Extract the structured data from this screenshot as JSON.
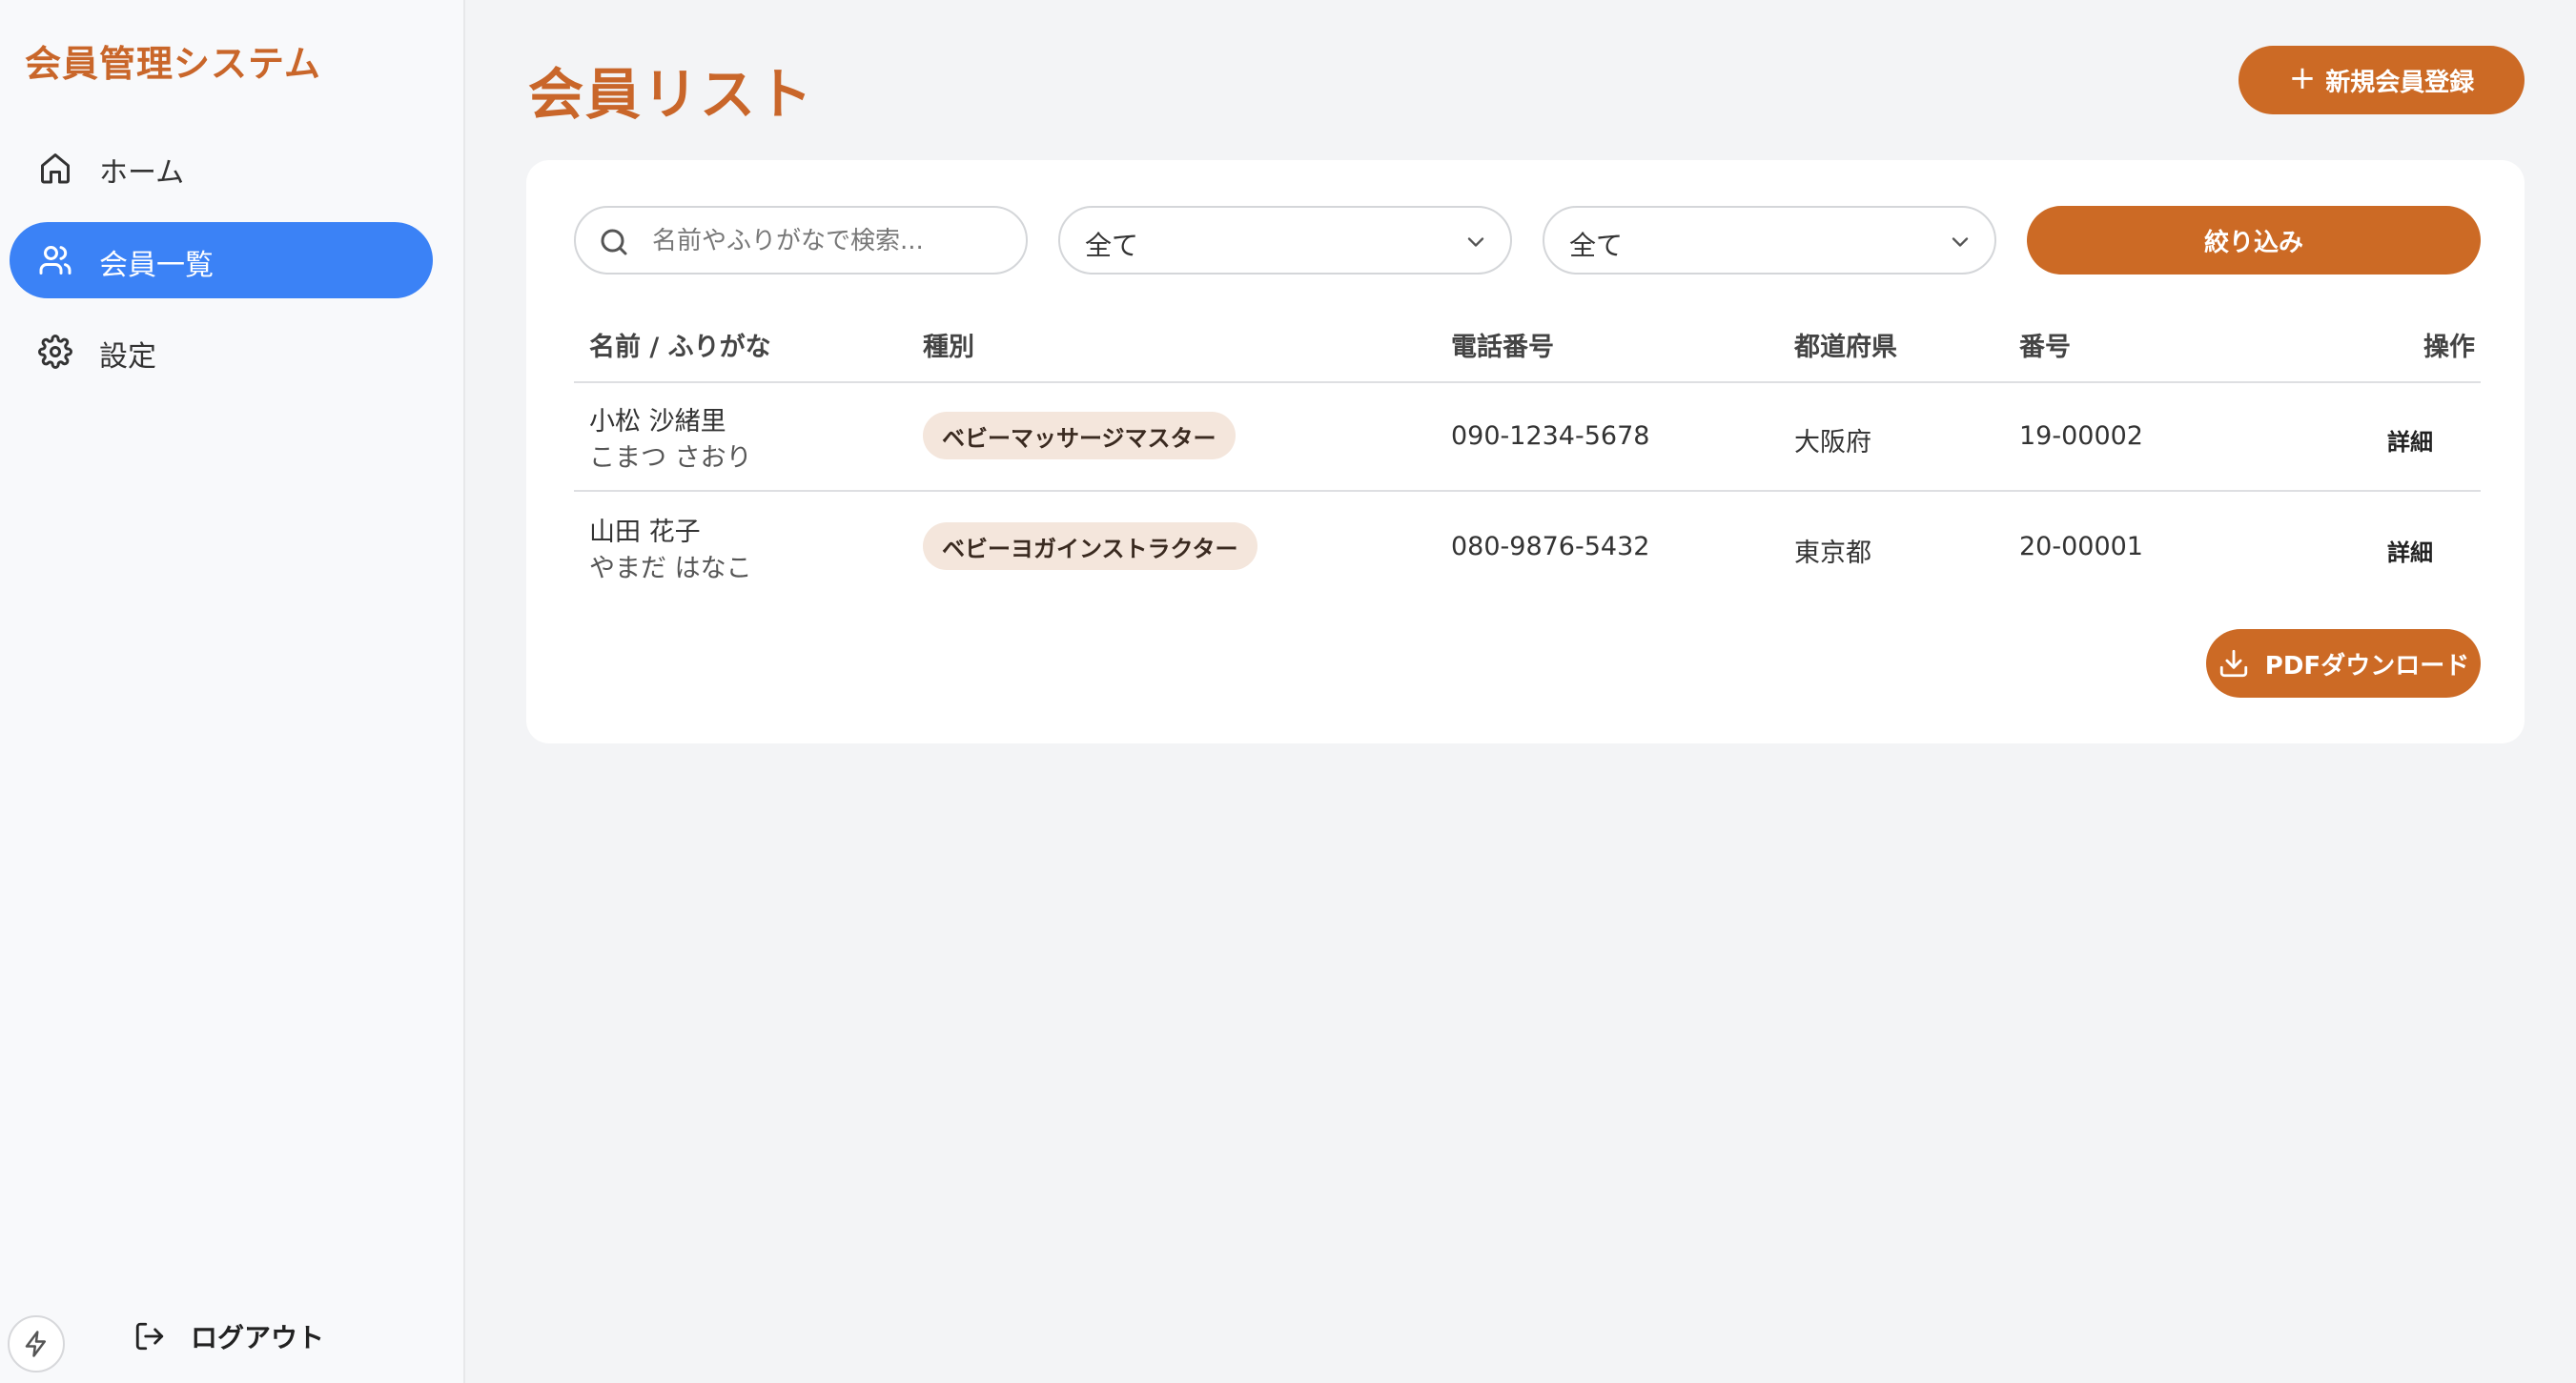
{
  "sidebar": {
    "brand": "会員管理システム",
    "items": [
      {
        "label": "ホーム",
        "icon": "home-icon"
      },
      {
        "label": "会員一覧",
        "icon": "users-icon"
      },
      {
        "label": "設定",
        "icon": "gear-icon"
      }
    ],
    "logout_label": "ログアウト"
  },
  "main": {
    "title": "会員リスト",
    "new_member_label": "新規会員登録",
    "search_placeholder": "名前やふりがなで検索...",
    "filter_type_value": "全て",
    "filter_pref_value": "全て",
    "filter_button_label": "絞り込み",
    "pdf_button_label": "PDFダウンロード"
  },
  "table": {
    "headers": [
      "名前 / ふりがな",
      "種別",
      "電話番号",
      "都道府県",
      "番号",
      "操作"
    ],
    "rows": [
      {
        "name": "小松 沙緒里",
        "kana": "こまつ さおり",
        "type": "ベビーマッサージマスター",
        "phone": "090-1234-5678",
        "pref": "大阪府",
        "number": "19-00002",
        "action": "詳細"
      },
      {
        "name": "山田 花子",
        "kana": "やまだ はなこ",
        "type": "ベビーヨガインストラクター",
        "phone": "080-9876-5432",
        "pref": "東京都",
        "number": "20-00001",
        "action": "詳細"
      }
    ]
  },
  "colors": {
    "accent": "#cc6a25",
    "active_nav": "#3b82f6",
    "badge_bg": "#f4e6dc"
  }
}
